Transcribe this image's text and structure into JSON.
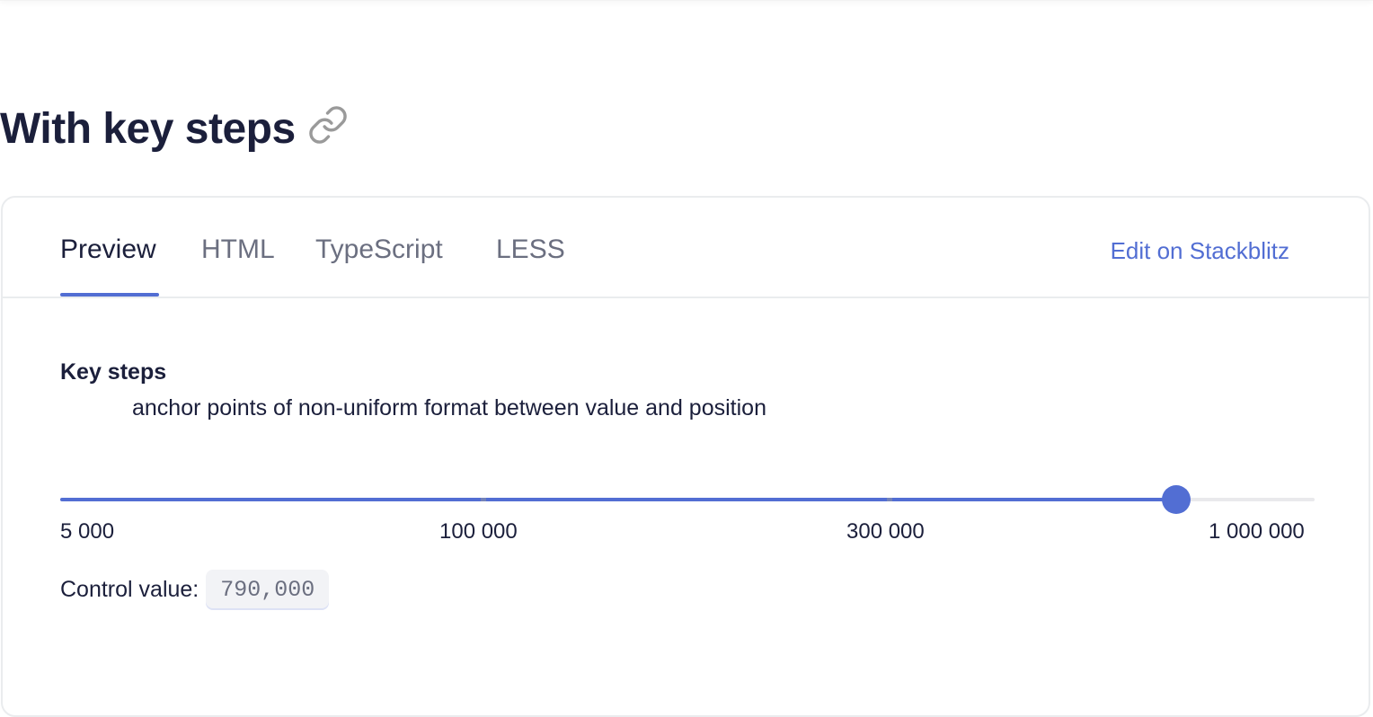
{
  "section": {
    "title": "With key steps",
    "link_icon": "link-icon"
  },
  "tabs": [
    {
      "label": "Preview",
      "active": true
    },
    {
      "label": "HTML",
      "active": false
    },
    {
      "label": "TypeScript",
      "active": false
    },
    {
      "label": "LESS",
      "active": false
    }
  ],
  "stackblitz_link": "Edit on Stackblitz",
  "content": {
    "title": "Key steps",
    "description": "anchor points of non-uniform format between value and position"
  },
  "slider": {
    "value_fraction": 0.89,
    "ticks": [
      "5 000",
      "100 000",
      "300 000",
      "1 000 000"
    ]
  },
  "control": {
    "label": "Control value:",
    "value": "790,000"
  },
  "colors": {
    "accent": "#526ed3",
    "text": "#1b1f3b",
    "muted": "#6b6f80",
    "border": "#eaecee"
  }
}
